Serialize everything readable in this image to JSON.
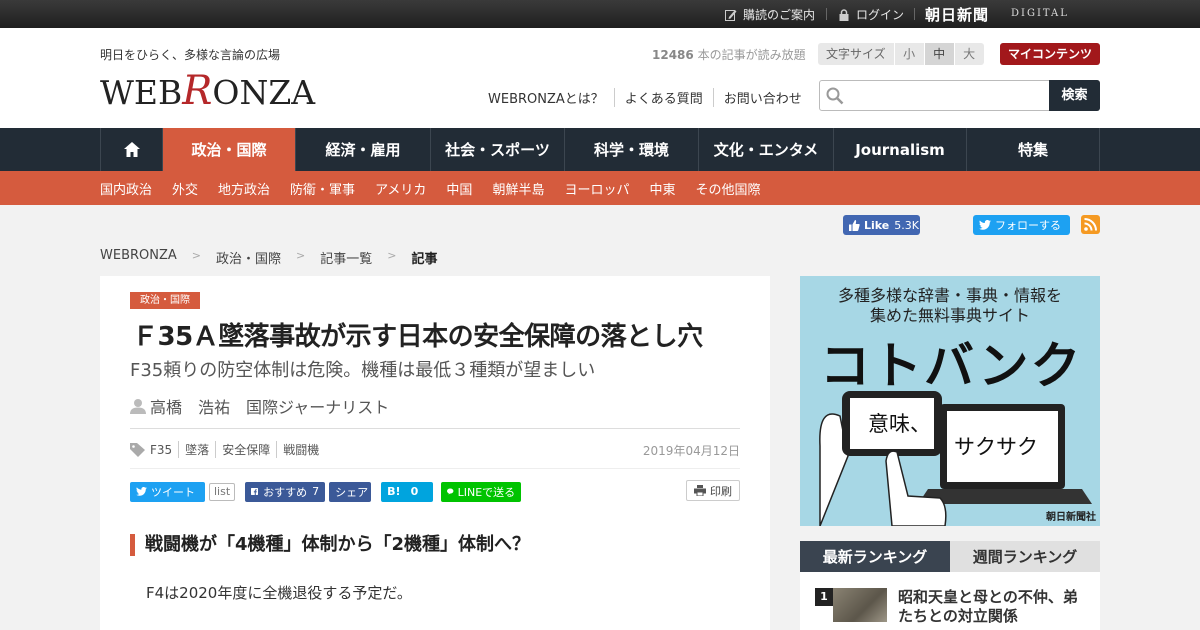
{
  "topbar": {
    "subscribe": "購読のご案内",
    "login": "ログイン",
    "asahi_logo": "朝日新聞",
    "asahi_digital": "DIGITAL"
  },
  "header": {
    "tagline": "明日をひらく、多様な言論の広場",
    "logo_a": "WEB",
    "logo_r": "R",
    "logo_b": "ONZA",
    "read_count_number": "12486",
    "read_count_text": " 本の記事が読み放題",
    "fontsize_label": "文字サイズ",
    "fontsize_small": "小",
    "fontsize_medium": "中",
    "fontsize_large": "大",
    "mycontents": "マイコンテンツ",
    "links": [
      "WEBRONZAとは？",
      "よくある質問",
      "お問い合わせ"
    ],
    "search_placeholder": "",
    "search_button": "検索"
  },
  "nav": {
    "items": [
      "政治・国際",
      "経済・雇用",
      "社会・スポーツ",
      "科学・環境",
      "文化・エンタメ",
      "Journalism",
      "特集"
    ],
    "sub_items": [
      "国内政治",
      "外交",
      "地方政治",
      "防衛・軍事",
      "アメリカ",
      "中国",
      "朝鮮半島",
      "ヨーロッパ",
      "中東",
      "その他国際"
    ]
  },
  "social": {
    "fb_like": "Like",
    "fb_like_count": "5.3K",
    "tw_follow": "フォローする"
  },
  "breadcrumb": [
    "WEBRONZA",
    "政治・国際",
    "記事一覧",
    "記事"
  ],
  "breadcrumb_sep": ">",
  "article": {
    "category": "政治・国際",
    "title": "Ｆ35Ａ墜落事故が示す日本の安全保障の落とし穴",
    "subtitle": "F35頼りの防空体制は危険。機種は最低３種類が望ましい",
    "author": "高橋　浩祐",
    "author_role": "国際ジャーナリスト",
    "tags": [
      "F35",
      "墜落",
      "安全保障",
      "戦闘機"
    ],
    "date": "2019年04月12日",
    "share": {
      "tweet": "ツイート",
      "list": "list",
      "fb_recommend": "おすすめ",
      "fb_count": "7",
      "fb_share": "シェア",
      "hatena": "B!",
      "hatena_count": "0",
      "line": "LINEで送る",
      "print": "印刷"
    },
    "section_heading": "戦闘機が「4機種」体制から「2機種」体制へ？",
    "body": "F4は2020年度に全機退役する予定だ。"
  },
  "ad": {
    "line1": "多種多様な辞書・事典・情報を",
    "line2": "集めた無料事典サイト",
    "brand": "コトバンク",
    "bubble1": "意味、",
    "bubble2": "サクサク",
    "publisher": "朝日新聞社"
  },
  "ranking": {
    "tab_latest": "最新ランキング",
    "tab_weekly": "週間ランキング",
    "items": [
      {
        "rank": "1",
        "title": "昭和天皇と母との不仲、弟たちとの対立関係"
      }
    ]
  },
  "colors": {
    "accent": "#d55b3e",
    "nav_bg": "#222c36",
    "mycontents": "#a2181b",
    "ad_bg": "#a7d7e5"
  }
}
